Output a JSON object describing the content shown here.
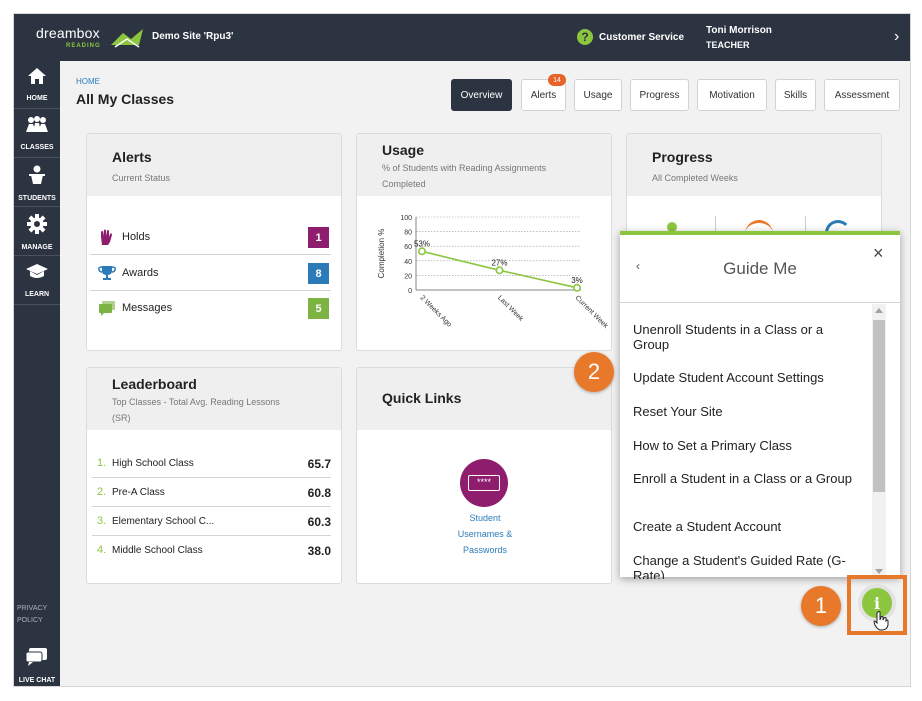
{
  "app": {
    "logo_text": "dreambox",
    "logo_sub": "READING",
    "site_name": "Demo Site 'Rpu3'",
    "customer_service": "Customer Service",
    "user_name": "Toni Morrison",
    "user_role": "TEACHER"
  },
  "sidebar": {
    "items": [
      {
        "label": "HOME",
        "icon": "home-icon"
      },
      {
        "label": "CLASSES",
        "icon": "classes-icon"
      },
      {
        "label": "STUDENTS",
        "icon": "student-icon"
      },
      {
        "label": "MANAGE",
        "icon": "gear-icon"
      },
      {
        "label": "LEARN",
        "icon": "graduation-cap-icon"
      }
    ],
    "privacy_line1": "PRIVACY",
    "privacy_line2": "POLICY",
    "live_chat": "LIVE CHAT"
  },
  "header": {
    "breadcrumb": "HOME",
    "title": "All My Classes",
    "tabs": [
      {
        "label": "Overview",
        "active": true
      },
      {
        "label": "Alerts",
        "badge": "14"
      },
      {
        "label": "Usage"
      },
      {
        "label": "Progress"
      },
      {
        "label": "Motivation"
      },
      {
        "label": "Skills"
      },
      {
        "label": "Assessment"
      }
    ]
  },
  "alerts_card": {
    "title": "Alerts",
    "subtitle": "Current Status",
    "rows": [
      {
        "label": "Holds",
        "count": "1",
        "color": "#8e1d6e",
        "icon": "hand-icon"
      },
      {
        "label": "Awards",
        "count": "8",
        "color": "#2b7bb9",
        "icon": "trophy-icon"
      },
      {
        "label": "Messages",
        "count": "5",
        "color": "#7cb342",
        "icon": "messages-icon"
      }
    ]
  },
  "usage_card": {
    "title": "Usage",
    "subtitle_line1": "% of Students with Reading Assignments",
    "subtitle_line2": "Completed"
  },
  "chart_data": {
    "type": "line",
    "categories": [
      "2 Weeks Ago",
      "Last Week",
      "Current Week"
    ],
    "values": [
      53,
      27,
      3
    ],
    "data_labels": [
      "53%",
      "27%",
      "3%"
    ],
    "ylabel": "Completion %",
    "ylim": [
      0,
      100
    ],
    "yticks": [
      "0",
      "20",
      "40",
      "60",
      "80",
      "100"
    ],
    "grid": true,
    "color": "#8cc63f"
  },
  "progress_card": {
    "title": "Progress",
    "subtitle": "All Completed Weeks"
  },
  "leaderboard_card": {
    "title": "Leaderboard",
    "subtitle_line1": "Top Classes - Total Avg. Reading Lessons",
    "subtitle_line2": "(SR)",
    "rows": [
      {
        "rank": "1.",
        "name": "High School Class",
        "score": "65.7"
      },
      {
        "rank": "2.",
        "name": "Pre-A Class",
        "score": "60.8"
      },
      {
        "rank": "3.",
        "name": "Elementary School C...",
        "score": "60.3"
      },
      {
        "rank": "4.",
        "name": "Middle School Class",
        "score": "38.0"
      }
    ]
  },
  "quicklinks_card": {
    "title": "Quick Links",
    "link_line1": "Student",
    "link_line2": "Usernames &",
    "link_line3": "Passwords",
    "icon_text": "****"
  },
  "guide": {
    "title": "Guide Me",
    "back": "‹",
    "close": "×",
    "items": [
      "Unenroll Students in a Class or a Group",
      "Update Student Account Settings",
      "Reset Your Site",
      "How to Set a Primary Class",
      "Enroll a Student in a Class or a Group",
      "Create a Student Account",
      "Change a Student's Guided Rate (G-Rate)"
    ]
  },
  "callouts": {
    "one": "1",
    "two": "2"
  },
  "info_button": "i"
}
